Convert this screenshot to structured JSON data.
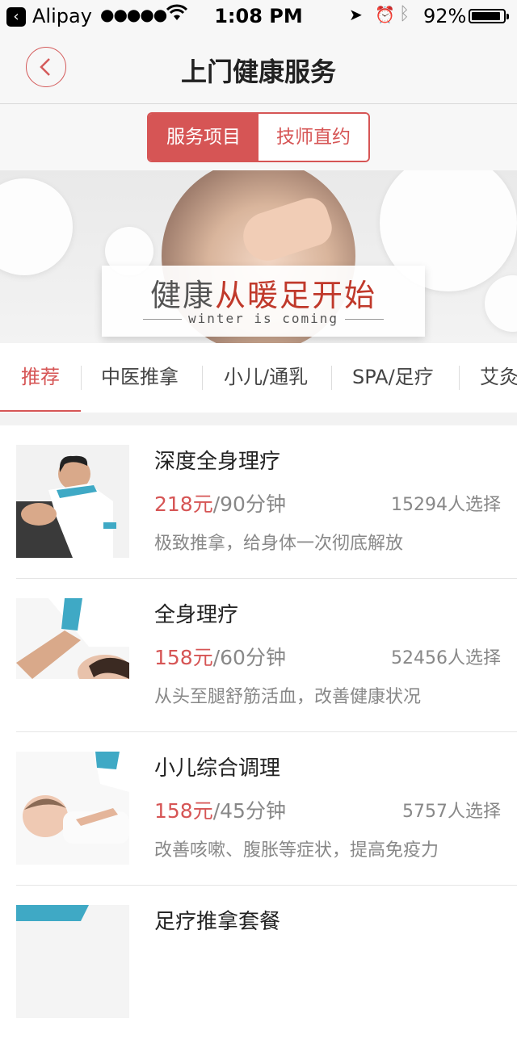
{
  "status_bar": {
    "app": "Alipay",
    "signal": "●●●●●",
    "time": "1:08 PM",
    "battery": "92%",
    "battery_level": 0.92
  },
  "nav": {
    "title": "上门健康服务"
  },
  "segment": {
    "items": [
      "服务项目",
      "技师直约"
    ],
    "selected": "服务项目"
  },
  "banner": {
    "headline_plain": "健康",
    "headline_red": "从暖足开始",
    "subline": "winter is coming"
  },
  "categories": {
    "items": [
      "推荐",
      "中医推拿",
      "小儿/通乳",
      "SPA/足疗",
      "艾灸"
    ],
    "selected": "推荐"
  },
  "services": [
    {
      "name": "深度全身理疗",
      "price": "218元",
      "duration": "/90分钟",
      "count": "15294人选择",
      "desc": "极致推拿，给身体一次彻底解放"
    },
    {
      "name": "全身理疗",
      "price": "158元",
      "duration": "/60分钟",
      "count": "52456人选择",
      "desc": "从头至腿舒筋活血，改善健康状况"
    },
    {
      "name": "小儿综合调理",
      "price": "158元",
      "duration": "/45分钟",
      "count": "5757人选择",
      "desc": "改善咳嗽、腹胀等症状，提高免疫力"
    },
    {
      "name": "足疗推拿套餐",
      "price": "",
      "duration": "",
      "count": "",
      "desc": ""
    }
  ],
  "colors": {
    "accent": "#d65555",
    "navbar_bg": "#f7f7f7"
  }
}
